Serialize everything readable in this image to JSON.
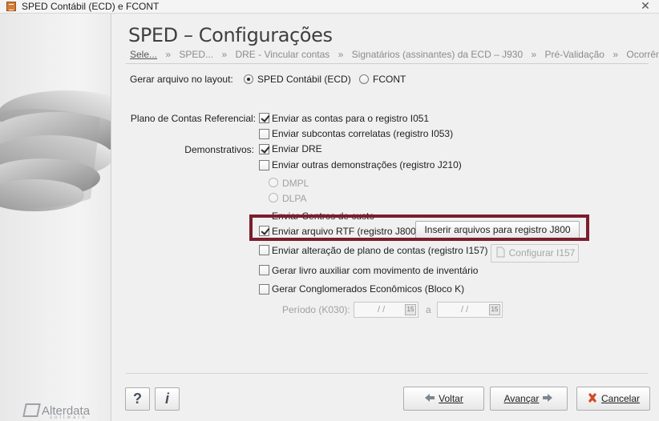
{
  "window": {
    "title": "SPED Contábil (ECD) e FCONT",
    "close_icon_glyph": "✕"
  },
  "brand": {
    "name": "Alterdata",
    "tagline": "software"
  },
  "header": {
    "title": "SPED – Configurações",
    "breadcrumbs": [
      {
        "label": "Sele..."
      },
      {
        "label": "SPED..."
      },
      {
        "label": "DRE - Vincular contas"
      },
      {
        "label": "Signatários (assinantes) da ECD – J930"
      },
      {
        "label": "Pré-Validação"
      },
      {
        "label": "Ocorrências"
      }
    ],
    "separator": "»"
  },
  "layout_choice": {
    "label": "Gerar arquivo no layout:",
    "options": [
      "SPED Contábil (ECD)",
      "FCONT"
    ],
    "selected": "SPED Contábil (ECD)"
  },
  "form": {
    "plano_label": "Plano de Contas Referencial:",
    "demonstrativos_label": "Demonstrativos:",
    "enviar_contas_i051": "Enviar as contas para o registro I051",
    "enviar_subcontas_i053": "Enviar subcontas correlatas (registro I053)",
    "enviar_dre": "Enviar DRE",
    "enviar_outras_j210": "Enviar outras demonstrações (registro J210)",
    "dmpl": "DMPL",
    "dlpa": "DLPA",
    "enviar_centros_custo": "Enviar Centros de custo",
    "enviar_rtf_j800": "Enviar arquivo RTF (registro J800)",
    "inserir_arquivos_j800": "Inserir arquivos para registro J800",
    "enviar_alteracao_i157": "Enviar alteração de plano de contas (registro I157)",
    "configurar_i157": "Configurar I157",
    "gerar_livro_auxiliar": "Gerar livro auxiliar com movimento de inventário",
    "gerar_conglomerados": "Gerar Conglomerados Econômicos (Bloco K)",
    "periodo_label": "Período (K030):",
    "date_start": "/ /",
    "date_end": "/ /",
    "date_separator": "a",
    "calendar_glyph": "15"
  },
  "footer": {
    "help_glyph": "?",
    "info_glyph": "i",
    "back_label": "Voltar",
    "next_label": "Avançar",
    "cancel_label": "Cancelar"
  }
}
